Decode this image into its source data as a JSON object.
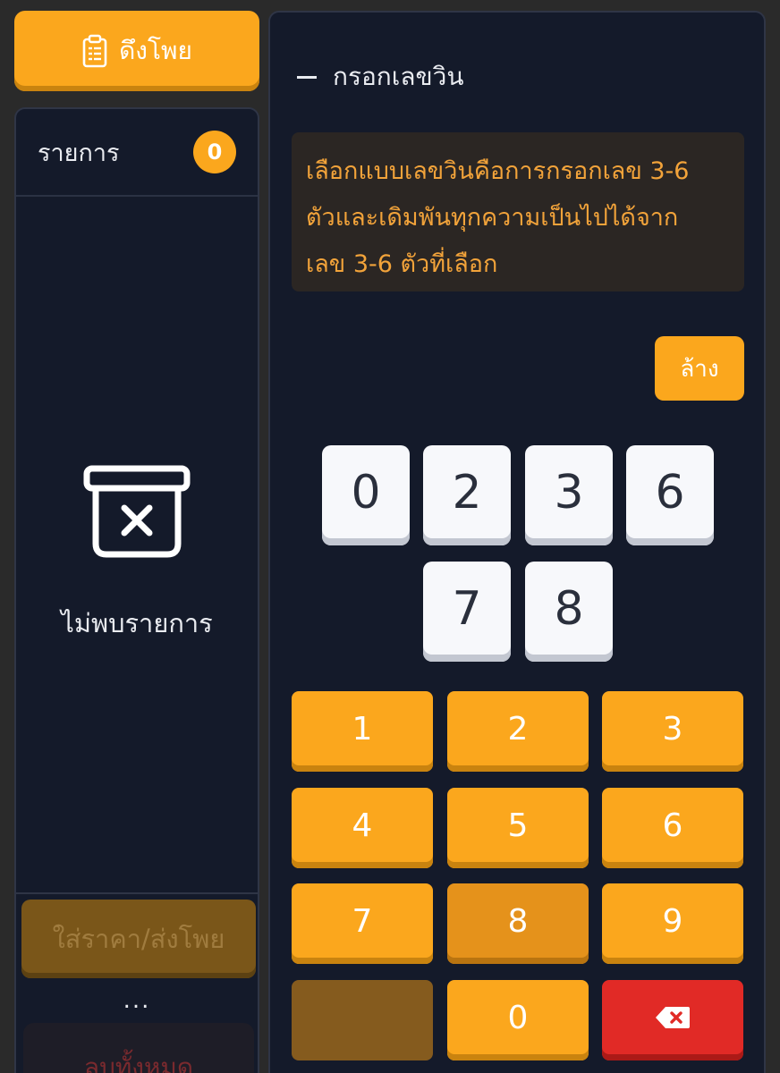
{
  "left": {
    "pull_label": "ดึงโพย",
    "list_title": "รายการ",
    "count": "0",
    "empty_text": "ไม่พบรายการ",
    "submit_label": "ใส่ราคา/ส่งโพย",
    "more_label": "...",
    "delete_all_label": "ลบทั้งหมด"
  },
  "panel": {
    "title": "กรอกเลขวิน",
    "notice_line1": "เลือกแบบเลขวินคือการกรอกเลข 3-6",
    "notice_line2": "ตัวและเดิมพันทุกความเป็นไปได้จาก",
    "notice_line3": "เลข 3-6 ตัวที่เลือก",
    "clear_label": "ล้าง"
  },
  "selected_digits": [
    "0",
    "2",
    "3",
    "6",
    "7",
    "8"
  ],
  "keypad": {
    "k1": "1",
    "k2": "2",
    "k3": "3",
    "k4": "4",
    "k5": "5",
    "k6": "6",
    "k7": "7",
    "k8": "8",
    "k9": "9",
    "k0": "0"
  },
  "colors": {
    "accent": "#fba71d",
    "background": "#141a2a",
    "danger": "#e12a26",
    "notice_text": "#f2a33a"
  },
  "icons": {
    "pull": "clipboard-icon",
    "empty": "empty-box-icon",
    "backspace": "backspace-icon"
  }
}
